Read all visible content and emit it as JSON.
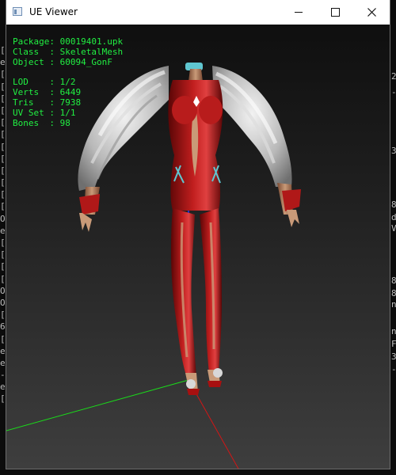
{
  "window": {
    "title": "UE Viewer"
  },
  "controls": {
    "minimize_icon": "minimize-icon",
    "maximize_icon": "maximize-icon",
    "close_icon": "close-icon"
  },
  "info": {
    "package_label": "Package:",
    "package_value": "00019401.upk",
    "class_label": "Class  :",
    "class_value": "SkeletalMesh",
    "object_label": "Object :",
    "object_value": "60094_GonF",
    "lod_label": "LOD    :",
    "lod_value": "1/2",
    "verts_label": "Verts  :",
    "verts_value": "6449",
    "tris_label": "Tris   :",
    "tris_value": "7938",
    "uvset_label": "UV Set :",
    "uvset_value": "1/1",
    "bones_label": "Bones  :",
    "bones_value": "98"
  },
  "background_console": {
    "left_chars": [
      "[",
      "e",
      "[",
      "[",
      "[",
      "[",
      "[",
      "[",
      "[",
      "[",
      "[",
      "[",
      "[",
      "[",
      "O",
      "e",
      "[",
      "[",
      "[",
      "[",
      "O",
      "O",
      "[",
      "6",
      "[",
      "e",
      "e",
      "-",
      "e",
      "["
    ],
    "right_chars": [
      "2",
      "-",
      "3",
      "8",
      "d",
      "V",
      "8",
      "8",
      "n",
      "n",
      "F",
      "3",
      "-"
    ]
  },
  "colors": {
    "info_text": "#21ef42",
    "axis_x": "#d21616",
    "axis_y": "#1adb1a",
    "axis_z": "#2030ff"
  }
}
